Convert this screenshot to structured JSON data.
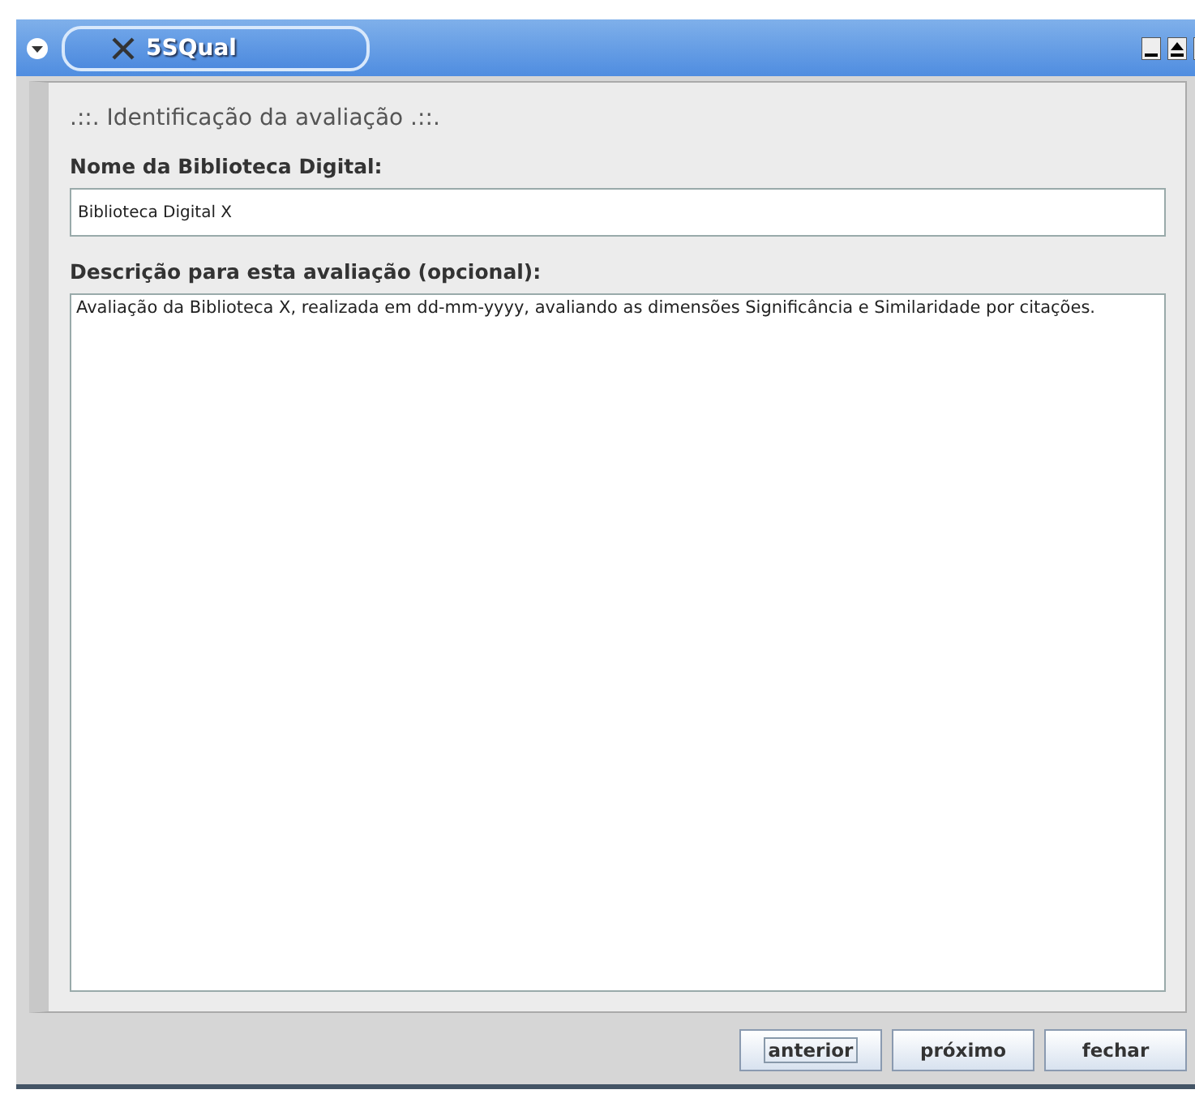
{
  "window": {
    "title": "5SQual"
  },
  "heading": ".::. Identificação da avaliação .::.",
  "name_field": {
    "label": "Nome da Biblioteca Digital:",
    "value": "Biblioteca Digital X"
  },
  "description_field": {
    "label": "Descrição para esta avaliação (opcional):",
    "value": "Avaliação da Biblioteca X, realizada em dd-mm-yyyy, avaliando as dimensões Significância e Similaridade por citações."
  },
  "buttons": [
    {
      "label": "anterior",
      "focused": true
    },
    {
      "label": "próximo",
      "focused": false
    },
    {
      "label": "fechar",
      "focused": false
    }
  ]
}
